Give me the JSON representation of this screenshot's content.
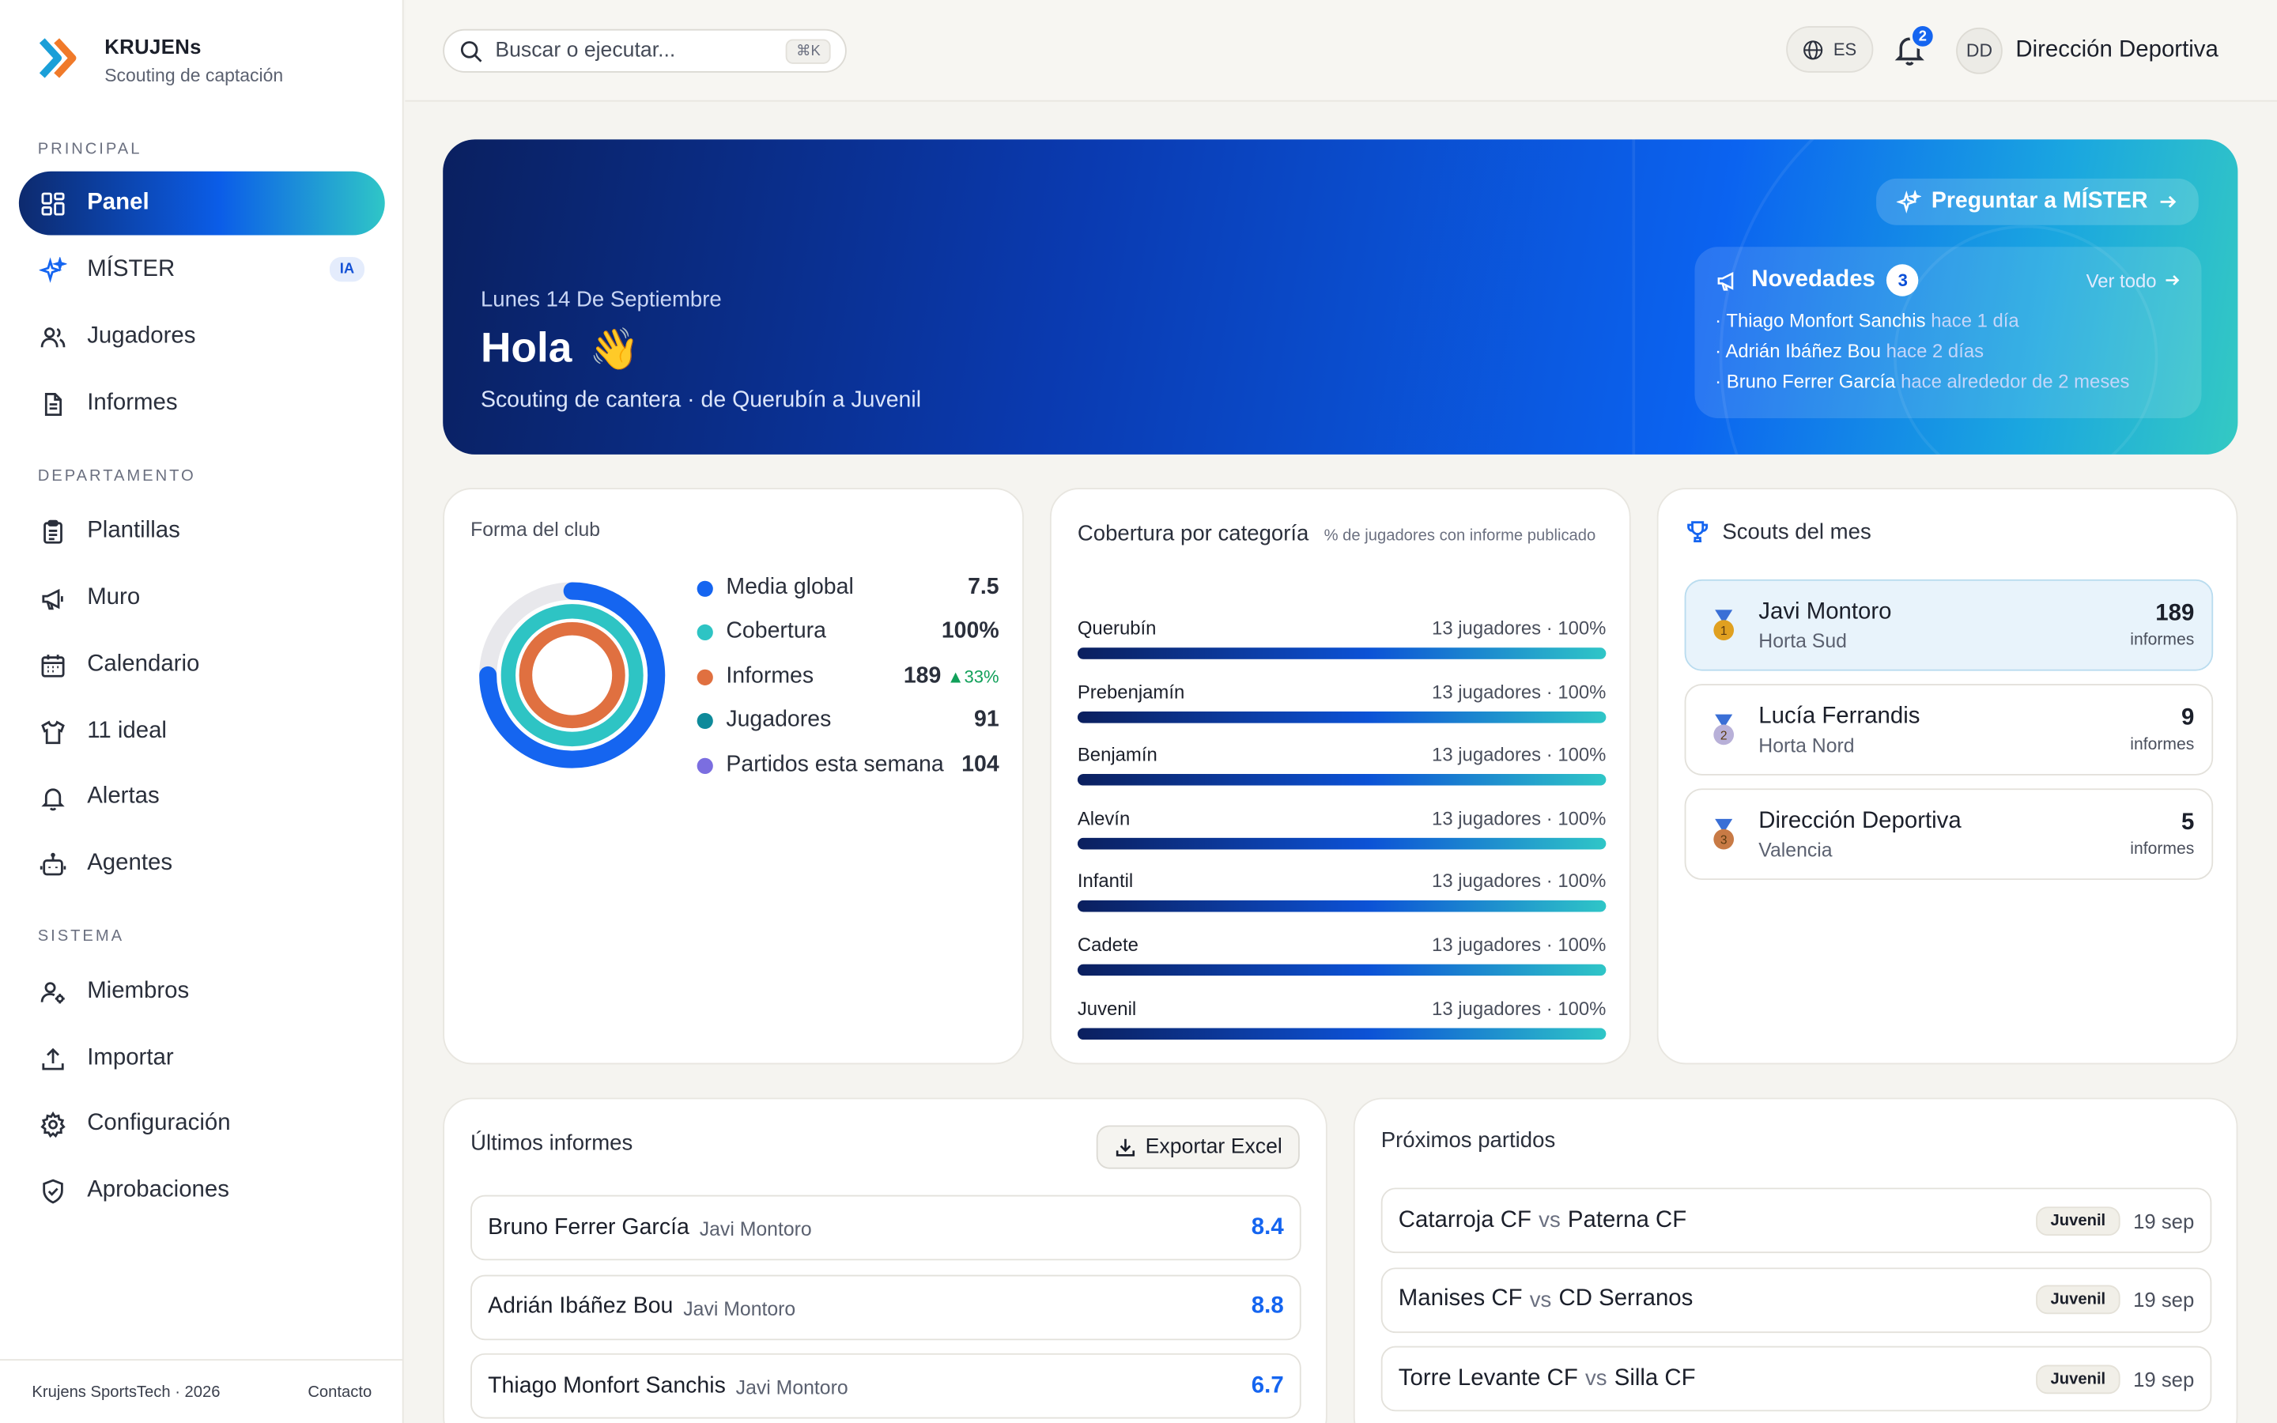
{
  "brand": {
    "name": "KRUJENs",
    "subtitle": "Scouting de captación"
  },
  "sidebar": {
    "sections": [
      {
        "title": "PRINCIPAL"
      },
      {
        "title": "DEPARTAMENTO"
      },
      {
        "title": "SISTEMA"
      }
    ],
    "items": [
      {
        "label": "Panel",
        "icon": "grid-icon",
        "active": true
      },
      {
        "label": "MÍSTER",
        "icon": "sparkles-icon",
        "badge": "IA"
      },
      {
        "label": "Jugadores",
        "icon": "users-icon"
      },
      {
        "label": "Informes",
        "icon": "document-icon"
      },
      {
        "label": "Plantillas",
        "icon": "clipboard-icon"
      },
      {
        "label": "Muro",
        "icon": "megaphone-icon"
      },
      {
        "label": "Calendario",
        "icon": "calendar-icon"
      },
      {
        "label": "11 ideal",
        "icon": "shirt-icon"
      },
      {
        "label": "Alertas",
        "icon": "bell-icon"
      },
      {
        "label": "Agentes",
        "icon": "bot-icon"
      },
      {
        "label": "Miembros",
        "icon": "user-gear-icon"
      },
      {
        "label": "Importar",
        "icon": "upload-icon"
      },
      {
        "label": "Configuración",
        "icon": "gear-icon"
      },
      {
        "label": "Aprobaciones",
        "icon": "shield-check-icon"
      }
    ],
    "footer": {
      "copyright": "Krujens SportsTech · 2026",
      "contact": "Contacto"
    }
  },
  "topbar": {
    "search_placeholder": "Buscar o ejecutar...",
    "search_shortcut": "⌘K",
    "language": "ES",
    "notifications_count": "2",
    "user_initials": "DD",
    "user_name": "Dirección Deportiva"
  },
  "hero": {
    "date": "Lunes 14 De Septiembre",
    "greeting": "Hola",
    "greeting_emoji": "👋",
    "subtitle": "Scouting de cantera · de Querubín a Juvenil",
    "ask_button": "Preguntar a MÍSTER",
    "news": {
      "title": "Novedades",
      "count": "3",
      "view_all": "Ver todo",
      "items": [
        {
          "name": "Thiago Monfort Sanchis",
          "when": "hace 1 día"
        },
        {
          "name": "Adrián Ibáñez Bou",
          "when": "hace 2 días"
        },
        {
          "name": "Bruno Ferrer García",
          "when": "hace alrededor de 2 meses"
        }
      ]
    }
  },
  "forma": {
    "title": "Forma del club",
    "stats": [
      {
        "label": "Media global",
        "value": "7.5",
        "color": "#1565f0"
      },
      {
        "label": "Cobertura",
        "value": "100%",
        "color": "#2ec4c4"
      },
      {
        "label": "Informes",
        "value": "189",
        "trend": "▲33%",
        "color": "#e07040"
      },
      {
        "label": "Jugadores",
        "value": "91",
        "color": "#0e8a9a"
      },
      {
        "label": "Partidos esta semana",
        "value": "104",
        "color": "#7b6ee0"
      }
    ],
    "rings": [
      {
        "name": "Media global",
        "fraction": 0.75,
        "color": "#1565f0"
      },
      {
        "name": "Cobertura",
        "fraction": 1.0,
        "color": "#2ec4c4"
      },
      {
        "name": "Informes",
        "fraction": 1.0,
        "color": "#e07040"
      }
    ]
  },
  "cobertura": {
    "title": "Cobertura por categoría",
    "note": "% de jugadores con informe publicado",
    "categories": [
      {
        "name": "Querubín",
        "meta": "13 jugadores · 100%",
        "percent": 100
      },
      {
        "name": "Prebenjamín",
        "meta": "13 jugadores · 100%",
        "percent": 100
      },
      {
        "name": "Benjamín",
        "meta": "13 jugadores · 100%",
        "percent": 100
      },
      {
        "name": "Alevín",
        "meta": "13 jugadores · 100%",
        "percent": 100
      },
      {
        "name": "Infantil",
        "meta": "13 jugadores · 100%",
        "percent": 100
      },
      {
        "name": "Cadete",
        "meta": "13 jugadores · 100%",
        "percent": 100
      },
      {
        "name": "Juvenil",
        "meta": "13 jugadores · 100%",
        "percent": 100
      }
    ]
  },
  "scouts": {
    "title": "Scouts del mes",
    "items": [
      {
        "rank": "1",
        "name": "Javi Montoro",
        "place": "Horta Sud",
        "count": "189",
        "unit": "informes",
        "medal_color": "#e0a020"
      },
      {
        "rank": "2",
        "name": "Lucía Ferrandis",
        "place": "Horta Nord",
        "count": "9",
        "unit": "informes",
        "medal_color": "#b8b0d8"
      },
      {
        "rank": "3",
        "name": "Dirección Deportiva",
        "place": "Valencia",
        "count": "5",
        "unit": "informes",
        "medal_color": "#c87a45"
      }
    ]
  },
  "informes": {
    "title": "Últimos informes",
    "export_label": "Exportar Excel",
    "rows": [
      {
        "player": "Bruno Ferrer García",
        "scout": "Javi Montoro",
        "score": "8.4"
      },
      {
        "player": "Adrián Ibáñez Bou",
        "scout": "Javi Montoro",
        "score": "8.8"
      },
      {
        "player": "Thiago Monfort Sanchis",
        "scout": "Javi Montoro",
        "score": "6.7"
      }
    ]
  },
  "partidos": {
    "title": "Próximos partidos",
    "vs": "vs",
    "rows": [
      {
        "home": "Catarroja CF",
        "away": "Paterna CF",
        "category": "Juvenil",
        "date": "19 sep"
      },
      {
        "home": "Manises CF",
        "away": "CD Serranos",
        "category": "Juvenil",
        "date": "19 sep"
      },
      {
        "home": "Torre Levante CF",
        "away": "Silla CF",
        "category": "Juvenil",
        "date": "19 sep"
      }
    ]
  }
}
